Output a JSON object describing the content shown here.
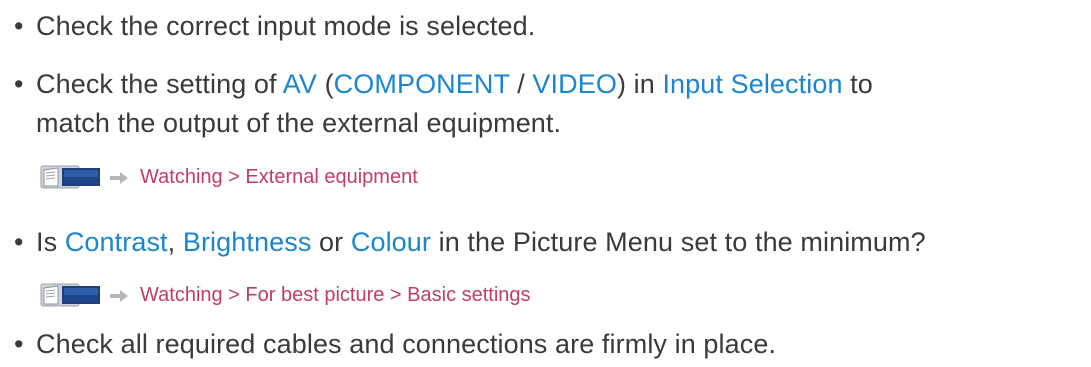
{
  "items": [
    {
      "segments": [
        "Check the correct input mode is selected."
      ]
    },
    {
      "line1": {
        "t1": "Check the setting of ",
        "av": "AV",
        "t2": " (",
        "component": "COMPONENT",
        "t3": " / ",
        "video": "VIDEO",
        "t4": ") in ",
        "input_selection": "Input Selection",
        "t5": " to"
      },
      "line2": "match the output of the external equipment."
    },
    {
      "t1": "Is ",
      "contrast": "Contrast",
      "t2": ", ",
      "brightness": "Brightness",
      "t3": " or ",
      "colour": "Colour",
      "t4": " in the Picture Menu set to the minimum?"
    },
    {
      "segments": [
        "Check all required cables and connections are firmly in place."
      ]
    }
  ],
  "refs": [
    {
      "path": "Watching > External equipment"
    },
    {
      "path": "Watching > For best picture > Basic settings"
    }
  ],
  "bullet": "•",
  "icons": [
    "ebook-help-icon",
    "arrow-right-icon"
  ],
  "colors": {
    "text": "#3a3a3a",
    "link": "#1a86d1",
    "reference": "#c43a6e"
  }
}
